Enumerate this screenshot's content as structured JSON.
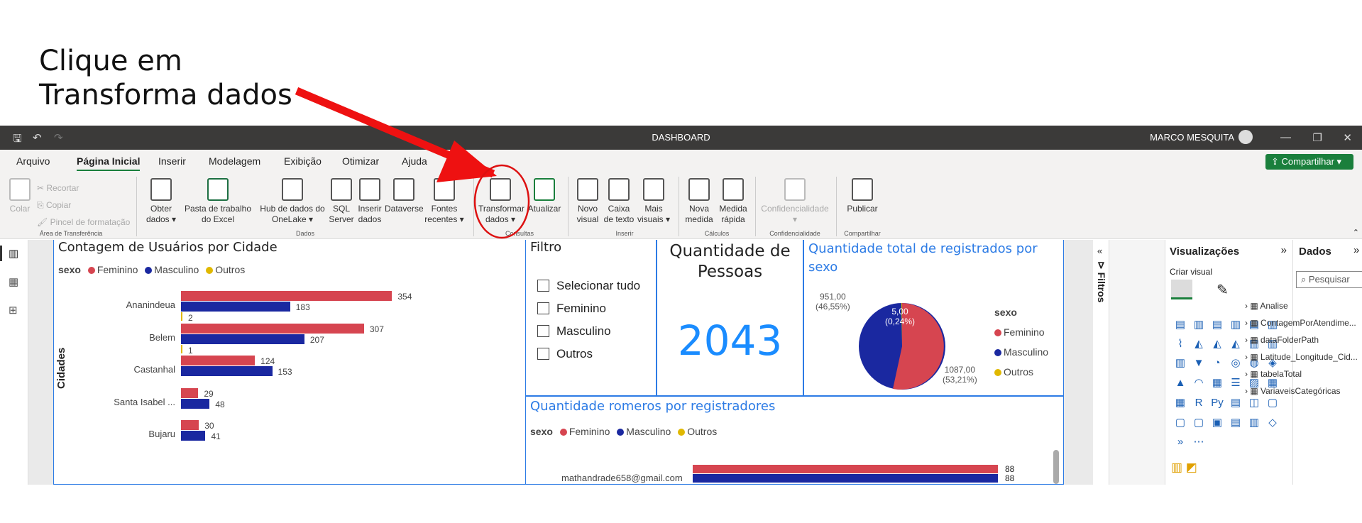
{
  "annotation": {
    "line1": "Clique em",
    "line2": "Transforma dados"
  },
  "titlebar": {
    "title": "DASHBOARD",
    "user": "MARCO MESQUITA"
  },
  "menu": [
    "Arquivo",
    "Página Inicial",
    "Inserir",
    "Modelagem",
    "Exibição",
    "Otimizar",
    "Ajuda"
  ],
  "share_label": "Compartilhar",
  "ribbon": {
    "clipboard": {
      "paste": "Colar",
      "cut": "Recortar",
      "copy": "Copiar",
      "format": "Pincel de formatação",
      "group": "Área de Transferência"
    },
    "data": {
      "get": "Obter dados",
      "excel": "Pasta de trabalho do Excel",
      "onelake": "Hub de dados do OneLake",
      "sql": "SQL Server",
      "insert": "Inserir dados",
      "dataverse": "Dataverse",
      "recent": "Fontes recentes",
      "group": "Dados"
    },
    "queries": {
      "transform": "Transformar dados",
      "refresh": "Atualizar",
      "group": "Consultas"
    },
    "insert": {
      "visual": "Novo visual",
      "textbox": "Caixa de texto",
      "more": "Mais visuais",
      "group": "Inserir"
    },
    "calc": {
      "measure": "Nova medida",
      "quick": "Medida rápida",
      "group": "Cálculos"
    },
    "sens": {
      "label": "Confidencialidade",
      "group": "Confidencialidade"
    },
    "share": {
      "publish": "Publicar",
      "group": "Compartilhar"
    }
  },
  "bar_chart": {
    "title": "Contagem de Usuários por Cidade",
    "legend_title": "sexo",
    "legend": [
      "Feminino",
      "Masculino",
      "Outros"
    ],
    "ylabel": "Cidades"
  },
  "filter": {
    "title": "Filtro",
    "options": [
      "Selecionar tudo",
      "Feminino",
      "Masculino",
      "Outros"
    ]
  },
  "card": {
    "title": "Quantidade de Pessoas",
    "value": "2043"
  },
  "pie": {
    "title": "Quantidade total de registrados por sexo",
    "legend_title": "sexo",
    "legend": [
      "Feminino",
      "Masculino",
      "Outros"
    ],
    "label_f": "1087,00",
    "label_f2": "(53,21%)",
    "label_m": "951,00",
    "label_m2": "(46,55%)",
    "label_o": "5,00",
    "label_o2": "(0,24%)"
  },
  "bottom_chart": {
    "title": "Quantidade romeros por registradores",
    "legend_title": "sexo",
    "legend": [
      "Feminino",
      "Masculino",
      "Outros"
    ],
    "category": "mathandrade658@gmail.com",
    "v1": "88",
    "v2": "88"
  },
  "panes": {
    "filters": "Filtros",
    "viz": "Visualizações",
    "create": "Criar visual",
    "data": "Dados",
    "search": "Pesquisar",
    "tables": [
      "Analise",
      "ContagemPorAtendime...",
      "dataFolderPath",
      "Latitude_Longitude_Cid...",
      "tabelaTotal",
      "VariaveisCategóricas"
    ]
  },
  "colors": {
    "female": "#d64550",
    "male": "#1a28a0",
    "other": "#e0b800",
    "accent": "#2c7be5"
  },
  "chart_data": {
    "type": "bar",
    "title": "Contagem de Usuários por Cidade",
    "ylabel": "Cidades",
    "categories": [
      "Ananindeua",
      "Belem",
      "Castanhal",
      "Santa Isabel ...",
      "Bujaru"
    ],
    "series": [
      {
        "name": "Feminino",
        "values": [
          354,
          307,
          124,
          29,
          30
        ]
      },
      {
        "name": "Masculino",
        "values": [
          183,
          207,
          153,
          48,
          41
        ]
      },
      {
        "name": "Outros",
        "values": [
          2,
          1,
          0,
          0,
          0
        ]
      }
    ]
  }
}
